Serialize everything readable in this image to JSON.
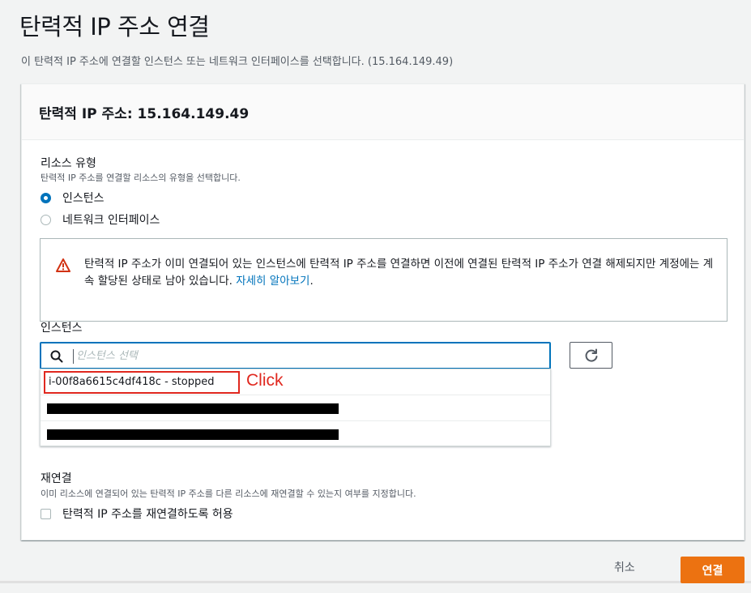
{
  "page": {
    "title": "탄력적 IP 주소 연결",
    "description": "이 탄력적 IP 주소에 연결할 인스턴스 또는 네트워크 인터페이스를 선택합니다. (15.164.149.49)"
  },
  "card": {
    "title": "탄력적 IP 주소: 15.164.149.49",
    "resource_type": {
      "label": "리소스 유형",
      "description": "탄력적 IP 주소를 연결할 리소스의 유형을 선택합니다.",
      "options": [
        {
          "label": "인스턴스",
          "checked": true
        },
        {
          "label": "네트워크 인터페이스",
          "checked": false
        }
      ]
    },
    "alert": {
      "icon": "warning-triangle-icon",
      "color": "#d13212",
      "text": "탄력적 IP 주소가 이미 연결되어 있는 인스턴스에 탄력적 IP 주소를 연결하면 이전에 연결된 탄력적 IP 주소가 연결 해제되지만 계정에는 계속 할당된 상태로 남아 있습니다.",
      "link": "자세히 알아보기",
      "after_link": "."
    },
    "instance": {
      "label": "인스턴스",
      "search_placeholder": "인스턴스 선택",
      "options": [
        {
          "label": "i-00f8a6615c4df418c - stopped"
        },
        {
          "label": ""
        },
        {
          "label": ""
        }
      ],
      "annotation": "Click"
    },
    "reassociation": {
      "label": "재연결",
      "description": "이미 리소스에 연결되어 있는 탄력적 IP 주소를 다른 리소스에 재연결할 수 있는지 여부를 지정합니다.",
      "checkbox_label": "탄력적 IP 주소를 재연결하도록 허용",
      "checked": false
    }
  },
  "footer": {
    "cancel_label": "취소",
    "submit_label": "연결"
  },
  "colors": {
    "primary": "#ec7211",
    "link": "#0073bb",
    "annotation": "#e0281f"
  }
}
